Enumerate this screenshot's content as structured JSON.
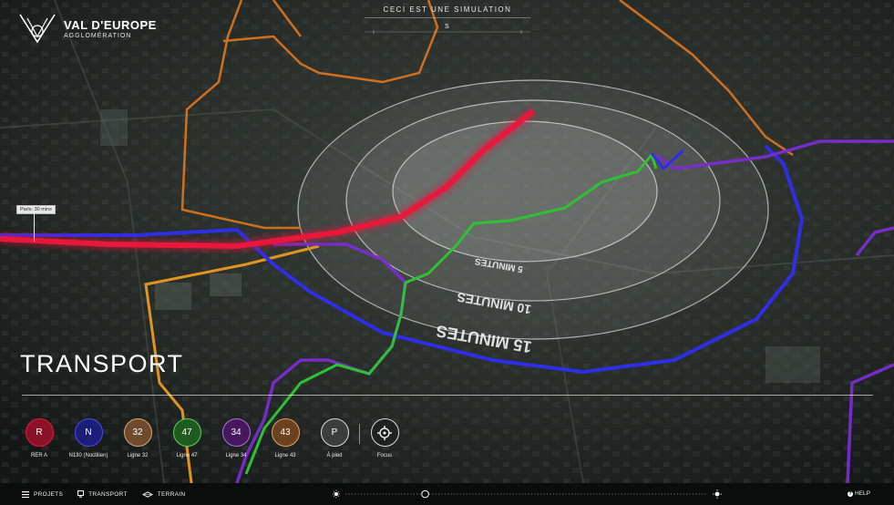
{
  "brand": {
    "title": "VAL D'EUROPE",
    "subtitle": "AGGLOMÉRATION"
  },
  "simulation": {
    "label": "CECI EST UNE SIMULATION",
    "compass": "S"
  },
  "map": {
    "callout": "Paris: 30 mins",
    "rings": [
      "5 MINUTES",
      "10 MINUTES",
      "15 MINUTES"
    ],
    "colors": {
      "rer_a": "#e8173b",
      "n130": "#2b2bde",
      "ligne_32": "#e08a22",
      "ligne_47": "#2ec233",
      "ligne_34": "#7a2ccf",
      "ligne_43": "#d9731e"
    }
  },
  "section": {
    "title": "TRANSPORT"
  },
  "lines": [
    {
      "code": "R",
      "label": "RER A",
      "fill": "#8a1226",
      "ring": "#e8173b",
      "icon": ""
    },
    {
      "code": "N",
      "label": "N130 (Noctilien)",
      "fill": "#1b1f78",
      "ring": "#4a4af0",
      "icon": ""
    },
    {
      "code": "32",
      "label": "Ligne 32",
      "fill": "#6e4b2c",
      "ring": "#d9a676",
      "icon": ""
    },
    {
      "code": "47",
      "label": "Ligne 47",
      "fill": "#1f5a21",
      "ring": "#5fcf5f",
      "icon": ""
    },
    {
      "code": "34",
      "label": "Ligne 34",
      "fill": "#46195e",
      "ring": "#a574d6",
      "icon": ""
    },
    {
      "code": "43",
      "label": "Ligne 43",
      "fill": "#6b4220",
      "ring": "#e0a060",
      "icon": ""
    },
    {
      "code": "P",
      "label": "À pied",
      "fill": "#3c3e3d",
      "ring": "#dcdcdc",
      "icon": ""
    },
    {
      "code": "",
      "label": "Focus",
      "fill": "#1d2120",
      "ring": "#dcdcdc",
      "icon": "crosshair-icon"
    }
  ],
  "bottom_nav": {
    "items": [
      {
        "label": "PROJETS",
        "icon": "menu-icon"
      },
      {
        "label": "TRANSPORT",
        "icon": "screen-icon"
      },
      {
        "label": "TERRAIN",
        "icon": "terrain-icon"
      }
    ],
    "help": "HELP",
    "time_slider_value": 0.22
  }
}
